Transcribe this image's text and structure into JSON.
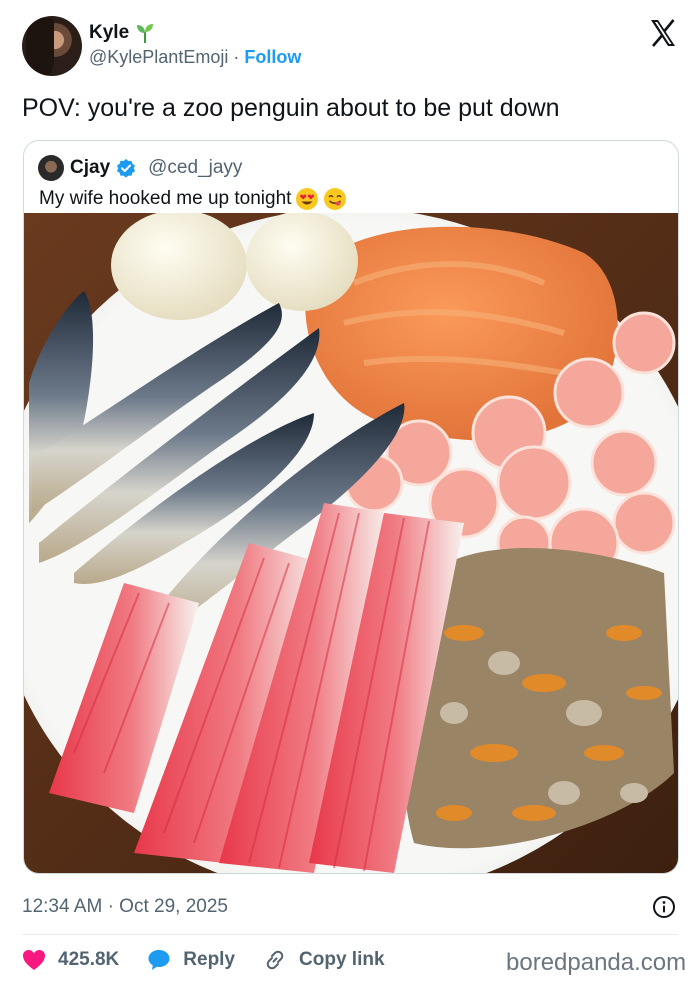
{
  "author": {
    "display_name": "Kyle",
    "handle": "@KylePlantEmoji",
    "separator": "·",
    "follow_label": "Follow",
    "name_icon": "seedling-icon"
  },
  "tweet": {
    "text": "POV: you're a zoo penguin about to be put down"
  },
  "quoted": {
    "display_name": "Cjay",
    "handle": "@ced_jayy",
    "verified_icon": "verified-badge-icon",
    "text": "My wife hooked me up tonight",
    "emojis": [
      "heart-eyes-emoji",
      "yum-emoji"
    ],
    "photo_icon": "seafood-plate-photo"
  },
  "meta": {
    "time": "12:34 AM",
    "separator": "·",
    "date": "Oct 29, 2025"
  },
  "actions": {
    "like_count": "425.8K",
    "reply_label": "Reply",
    "copy_label": "Copy link"
  },
  "watermark": "boredpanda.com",
  "colors": {
    "accent": "#1d9bf0",
    "like": "#f91880",
    "text": "#0f1419",
    "muted": "#536471"
  }
}
